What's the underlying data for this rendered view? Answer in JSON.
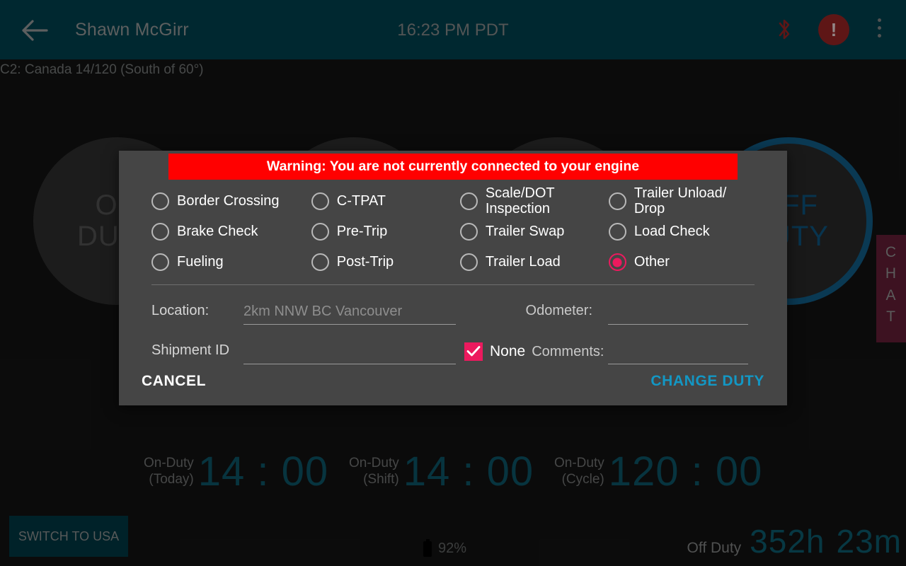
{
  "header": {
    "back_icon": "back-arrow-icon",
    "driver_name": "Shawn McGirr",
    "clock": "16:23 PM PDT",
    "bluetooth_icon": "bluetooth-disconnected-icon",
    "bluetooth_color": "#8f2222",
    "alert_icon": "alert-exclamation-icon",
    "alert_color": "#8f2222",
    "overflow_icon": "overflow-menu-icon",
    "background_color": "#003d4a"
  },
  "ruleset": {
    "text": "C2: Canada 14/120 (South of 60°)"
  },
  "duty_circles": [
    {
      "line1": "ON",
      "line2": "DUTY",
      "style": "plain"
    },
    {
      "line1": "",
      "line2": "",
      "style": "plain"
    },
    {
      "line1": "",
      "line2": "",
      "style": "plain"
    },
    {
      "line1": "OFF",
      "line2": "DUTY",
      "style": "ring",
      "ring_color": "#10577f"
    }
  ],
  "chat_tab": {
    "label": "CHAT",
    "letters": [
      "C",
      "H",
      "A",
      "T"
    ],
    "background_color": "#5d1c32"
  },
  "timers": [
    {
      "label_line1": "On-Duty",
      "label_line2": "(Today)",
      "value": "14 : 00"
    },
    {
      "label_line1": "On-Duty",
      "label_line2": "(Shift)",
      "value": "14 : 00"
    },
    {
      "label_line1": "On-Duty",
      "label_line2": "(Cycle)",
      "value": "120 : 00"
    }
  ],
  "bottom": {
    "switch_button": "SWITCH TO USA",
    "battery_icon": "battery-icon",
    "battery_percent": "92%",
    "offduty_label": "Off Duty",
    "offduty_hours": "352h",
    "offduty_minutes": "23m"
  },
  "dialog": {
    "warning": "Warning: You are not currently connected to your engine",
    "warning_color": "#ff0000",
    "accent_color": "#ec1a5e",
    "columns": [
      {
        "options": [
          {
            "label": "Border Crossing",
            "selected": false
          },
          {
            "label": "Brake Check",
            "selected": false
          },
          {
            "label": "Fueling",
            "selected": false
          }
        ]
      },
      {
        "options": [
          {
            "label": "C-TPAT",
            "selected": false
          },
          {
            "label": "Pre-Trip",
            "selected": false
          },
          {
            "label": "Post-Trip",
            "selected": false
          }
        ]
      },
      {
        "options": [
          {
            "label": "Scale/DOT Inspection",
            "selected": false
          },
          {
            "label": "Trailer Swap",
            "selected": false
          },
          {
            "label": "Trailer Load",
            "selected": false
          }
        ]
      },
      {
        "options": [
          {
            "label": "Trailer Unload/ Drop",
            "selected": false
          },
          {
            "label": "Load Check",
            "selected": false
          },
          {
            "label": "Other",
            "selected": true
          }
        ]
      }
    ],
    "fields": {
      "location_label": "Location:",
      "location_value": "",
      "location_placeholder": "2km NNW BC Vancouver",
      "odometer_label": "Odometer:",
      "odometer_value": "",
      "shipment_label": "Shipment ID",
      "shipment_value": "",
      "none_label": "None",
      "none_checked": true,
      "comments_label": "Comments:",
      "comments_value": ""
    },
    "actions": {
      "cancel": "CANCEL",
      "confirm": "CHANGE DUTY"
    }
  }
}
